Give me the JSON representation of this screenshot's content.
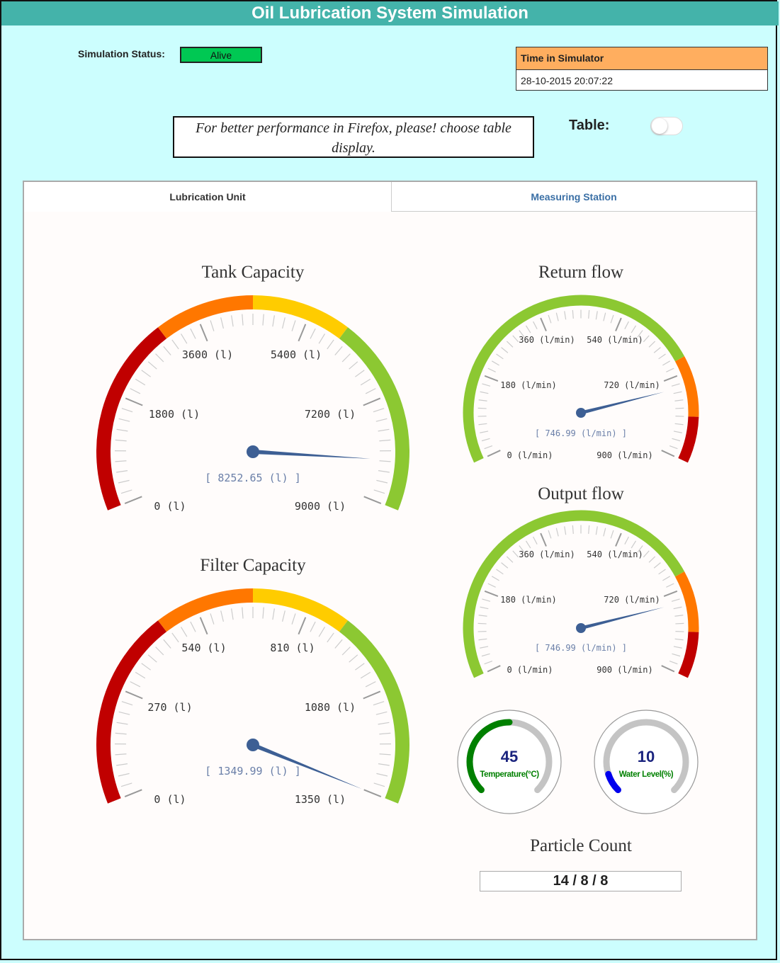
{
  "header": {
    "title": "Oil Lubrication System Simulation"
  },
  "status": {
    "label": "Simulation Status:",
    "value": "Alive",
    "color": "#00c853"
  },
  "time": {
    "label": "Time in Simulator",
    "value": "28-10-2015 20:07:22"
  },
  "notice": {
    "text": "For better performance in Firefox, please! choose table display."
  },
  "table_toggle": {
    "label": "Table:",
    "on": false
  },
  "tabs": [
    {
      "label": "Lubrication Unit",
      "active": true
    },
    {
      "label": "Measuring Station",
      "active": false
    }
  ],
  "colors": {
    "red": "#c00000",
    "orange": "#ff7700",
    "yellow": "#ffcc00",
    "green": "#8cc832",
    "needle": "#3d5f94"
  },
  "gauges": [
    {
      "id": "tank-capacity",
      "title": "Tank Capacity",
      "min": 0,
      "max": 9000,
      "unit": "(l)",
      "labels": [
        "0",
        "1800",
        "3600",
        "5400",
        "7200",
        "9000"
      ],
      "value": 8252.65,
      "readout": "[ 8252.65 (l) ]",
      "bands": [
        {
          "from": 0,
          "to": 3000,
          "color": "red"
        },
        {
          "from": 3000,
          "to": 4500,
          "color": "orange"
        },
        {
          "from": 4500,
          "to": 6000,
          "color": "yellow"
        },
        {
          "from": 6000,
          "to": 9000,
          "color": "green"
        }
      ]
    },
    {
      "id": "filter-capacity",
      "title": "Filter Capacity",
      "min": 0,
      "max": 1350,
      "unit": "(l)",
      "labels": [
        "0",
        "270",
        "540",
        "810",
        "1080",
        "1350"
      ],
      "value": 1349.99,
      "readout": "[ 1349.99 (l) ]",
      "bands": [
        {
          "from": 0,
          "to": 450,
          "color": "red"
        },
        {
          "from": 450,
          "to": 675,
          "color": "orange"
        },
        {
          "from": 675,
          "to": 900,
          "color": "yellow"
        },
        {
          "from": 900,
          "to": 1350,
          "color": "green"
        }
      ]
    },
    {
      "id": "return-flow",
      "title": "Return flow",
      "min": 0,
      "max": 900,
      "unit": "(l/min)",
      "labels": [
        "0",
        "180",
        "360",
        "540",
        "720",
        "900"
      ],
      "value": 746.99,
      "readout": "[ 746.99 (l/min) ]",
      "bands": [
        {
          "from": 0,
          "to": 690,
          "color": "green"
        },
        {
          "from": 690,
          "to": 810,
          "color": "orange"
        },
        {
          "from": 810,
          "to": 900,
          "color": "red"
        }
      ]
    },
    {
      "id": "output-flow",
      "title": "Output flow",
      "min": 0,
      "max": 900,
      "unit": "(l/min)",
      "labels": [
        "0",
        "180",
        "360",
        "540",
        "720",
        "900"
      ],
      "value": 746.99,
      "readout": "[ 746.99 (l/min) ]",
      "bands": [
        {
          "from": 0,
          "to": 690,
          "color": "green"
        },
        {
          "from": 690,
          "to": 810,
          "color": "orange"
        },
        {
          "from": 810,
          "to": 900,
          "color": "red"
        }
      ]
    }
  ],
  "mini_gauges": [
    {
      "id": "temperature",
      "label": "Temperature(°C)",
      "value": "45",
      "fraction": 0.5,
      "color": "#008000",
      "value_color": "#1a237e"
    },
    {
      "id": "water-level",
      "label": "Water Level(%)",
      "value": "10",
      "fraction": 0.1,
      "color": "#0000ee",
      "value_color": "#1a237e"
    }
  ],
  "particle_count": {
    "title": "Particle Count",
    "value": "14 / 8 / 8"
  }
}
